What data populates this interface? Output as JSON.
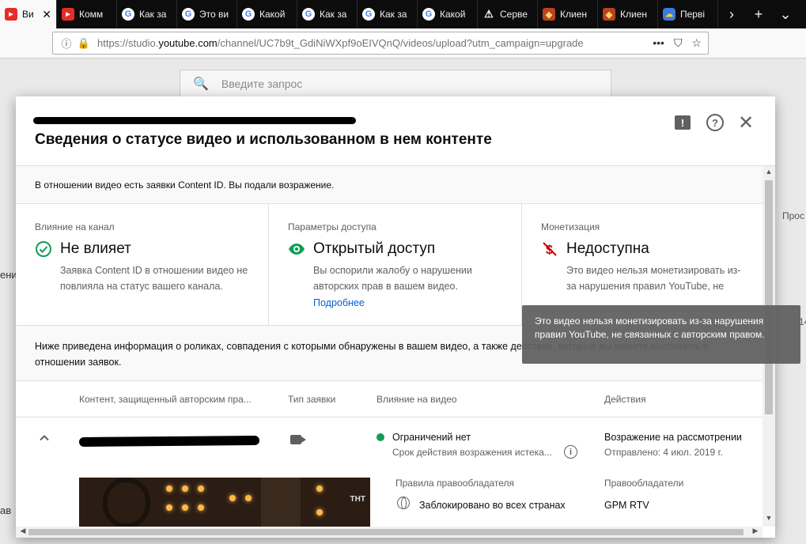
{
  "browser": {
    "tabs": [
      {
        "icon": "youtube",
        "label": "Ви",
        "active": true
      },
      {
        "icon": "youtube",
        "label": "Комм"
      },
      {
        "icon": "google",
        "label": "Как за"
      },
      {
        "icon": "google",
        "label": "Это ви"
      },
      {
        "icon": "google",
        "label": "Какой"
      },
      {
        "icon": "google",
        "label": "Как за"
      },
      {
        "icon": "google",
        "label": "Как за"
      },
      {
        "icon": "google",
        "label": "Какой"
      },
      {
        "icon": "warning",
        "label": "Серве"
      },
      {
        "icon": "game",
        "label": "Клиен"
      },
      {
        "icon": "game",
        "label": "Клиен"
      },
      {
        "icon": "cloud",
        "label": "Перві"
      }
    ],
    "url_prefix": "https://studio.",
    "url_domain": "youtube.com",
    "url_rest": "/channel/UC7b9t_GdiNiWXpf9oEIVQnQ/videos/upload?utm_campaign=upgrade"
  },
  "background": {
    "search_placeholder": "Введите запрос",
    "side_fragments": [
      "Прос",
      "ени",
      "14",
      "ав"
    ]
  },
  "dialog": {
    "title": "Сведения о статусе видео и использованном в нем контенте",
    "banner": "В отношении видео есть заявки Content ID. Вы подали возражение.",
    "cards": {
      "channel": {
        "label": "Влияние на канал",
        "value": "Не влияет",
        "desc": "Заявка Content ID в отношении видео не повлияла на статус вашего канала."
      },
      "access": {
        "label": "Параметры доступа",
        "value": "Открытый доступ",
        "desc": "Вы оспорили жалобу о нарушении авторских прав в вашем видео.",
        "link": "Подробнее"
      },
      "monetization": {
        "label": "Монетизация",
        "value": "Недоступна",
        "desc": "Это видео нельзя монетизировать из-за нарушения правил YouTube, не"
      }
    },
    "info": "Ниже приведена информация о роликах, совпадения с которыми обнаружены в вашем видео, а также действия, которые вы можете выполнить в отношении заявок.",
    "table": {
      "headers": {
        "content": "Контент, защищенный авторским пра...",
        "claim_type": "Тип заявки",
        "effect": "Влияние на видео",
        "actions": "Действия"
      },
      "row": {
        "effect_status": "Ограничений нет",
        "effect_detail": "Срок действия возражения истека...",
        "action_status": "Возражение на рассмотрении",
        "action_sent": "Отправлено: 4 июл. 2019 г.",
        "policy_label": "Правила правообладателя",
        "policy_value": "Заблокировано во всех странах",
        "owners_label": "Правообладатели",
        "owners_value": "GPM RTV",
        "thumb_logo": "ТНТ"
      }
    },
    "tooltip": "Это видео нельзя монетизировать из-за нарушения правил YouTube, не связанных с авторским правом."
  },
  "colors": {
    "green": "#0f9d58",
    "link": "#065fd4",
    "monetization_icon": "#c00"
  }
}
